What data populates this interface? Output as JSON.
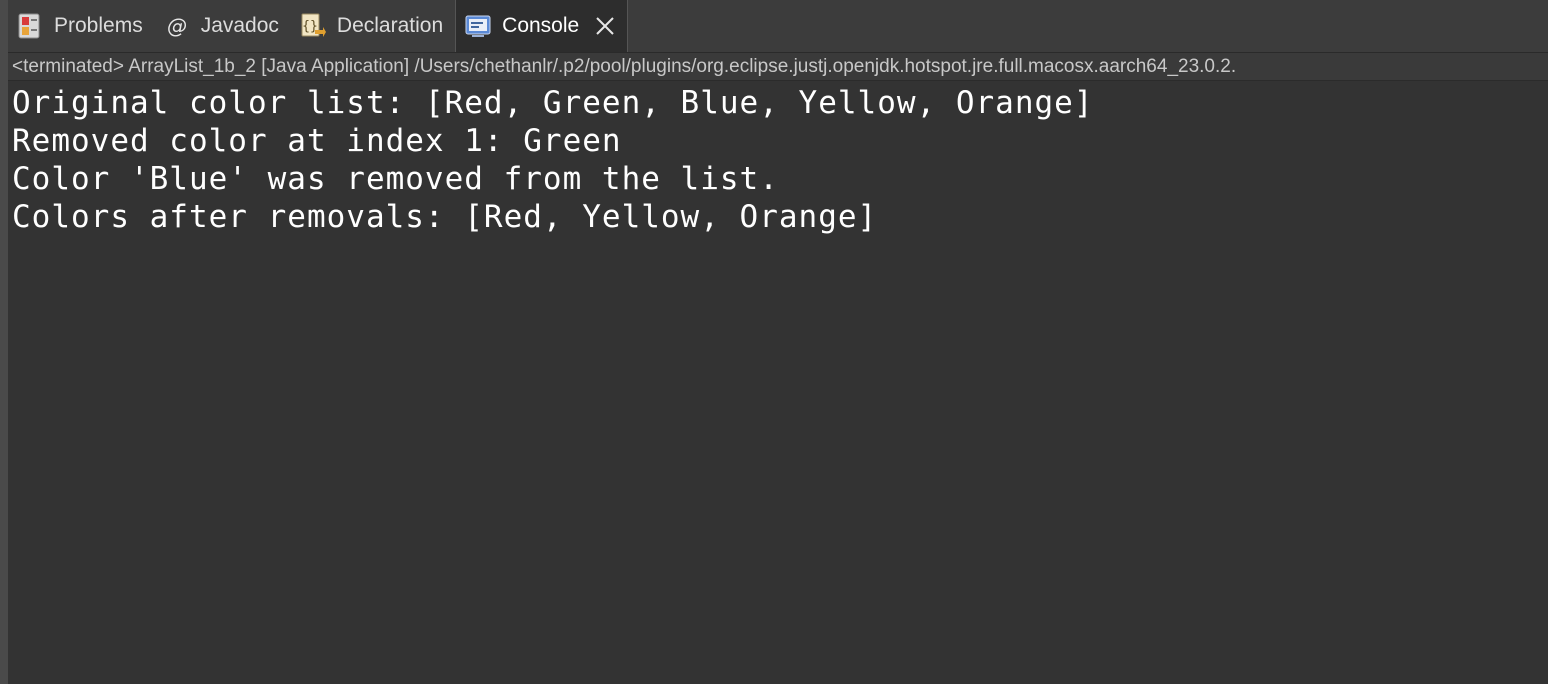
{
  "tabs": [
    {
      "label": "Problems",
      "icon": "problems-icon",
      "active": false
    },
    {
      "label": "Javadoc",
      "icon": "at-icon",
      "active": false
    },
    {
      "label": "Declaration",
      "icon": "declaration-icon",
      "active": false
    },
    {
      "label": "Console",
      "icon": "console-icon",
      "active": true
    }
  ],
  "console": {
    "status": "<terminated> ArrayList_1b_2 [Java Application] /Users/chethanlr/.p2/pool/plugins/org.eclipse.justj.openjdk.hotspot.jre.full.macosx.aarch64_23.0.2.",
    "lines": [
      "Original color list: [Red, Green, Blue, Yellow, Orange]",
      "Removed color at index 1: Green",
      "Color 'Blue' was removed from the list.",
      "Colors after removals: [Red, Yellow, Orange]"
    ]
  },
  "colors": {
    "background": "#333333",
    "tab_bar": "#3c3c3c",
    "active_tab": "#2d2d2d",
    "console_text": "#ffffff",
    "status_text": "#c8c8c8"
  }
}
